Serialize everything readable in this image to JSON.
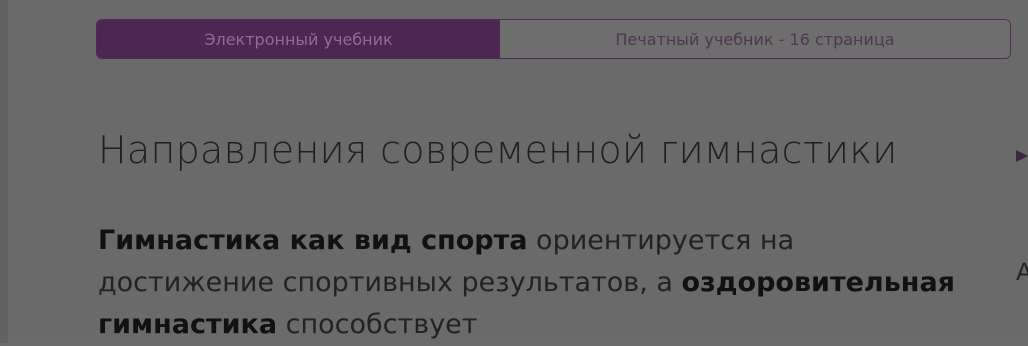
{
  "tabs": {
    "electronic": "Электронный учебник",
    "printed": "Печатный учебник - 16 страница"
  },
  "article": {
    "title": "Направления современной гимнастики",
    "p1_bold1": "Гимнастика как вид спорта",
    "p1_text1": " ориентируется на достижение спортивных результатов, а ",
    "p1_bold2": "оздоровительная гимнастика",
    "p1_text2": " способствует"
  },
  "side": {
    "letter": "А"
  }
}
